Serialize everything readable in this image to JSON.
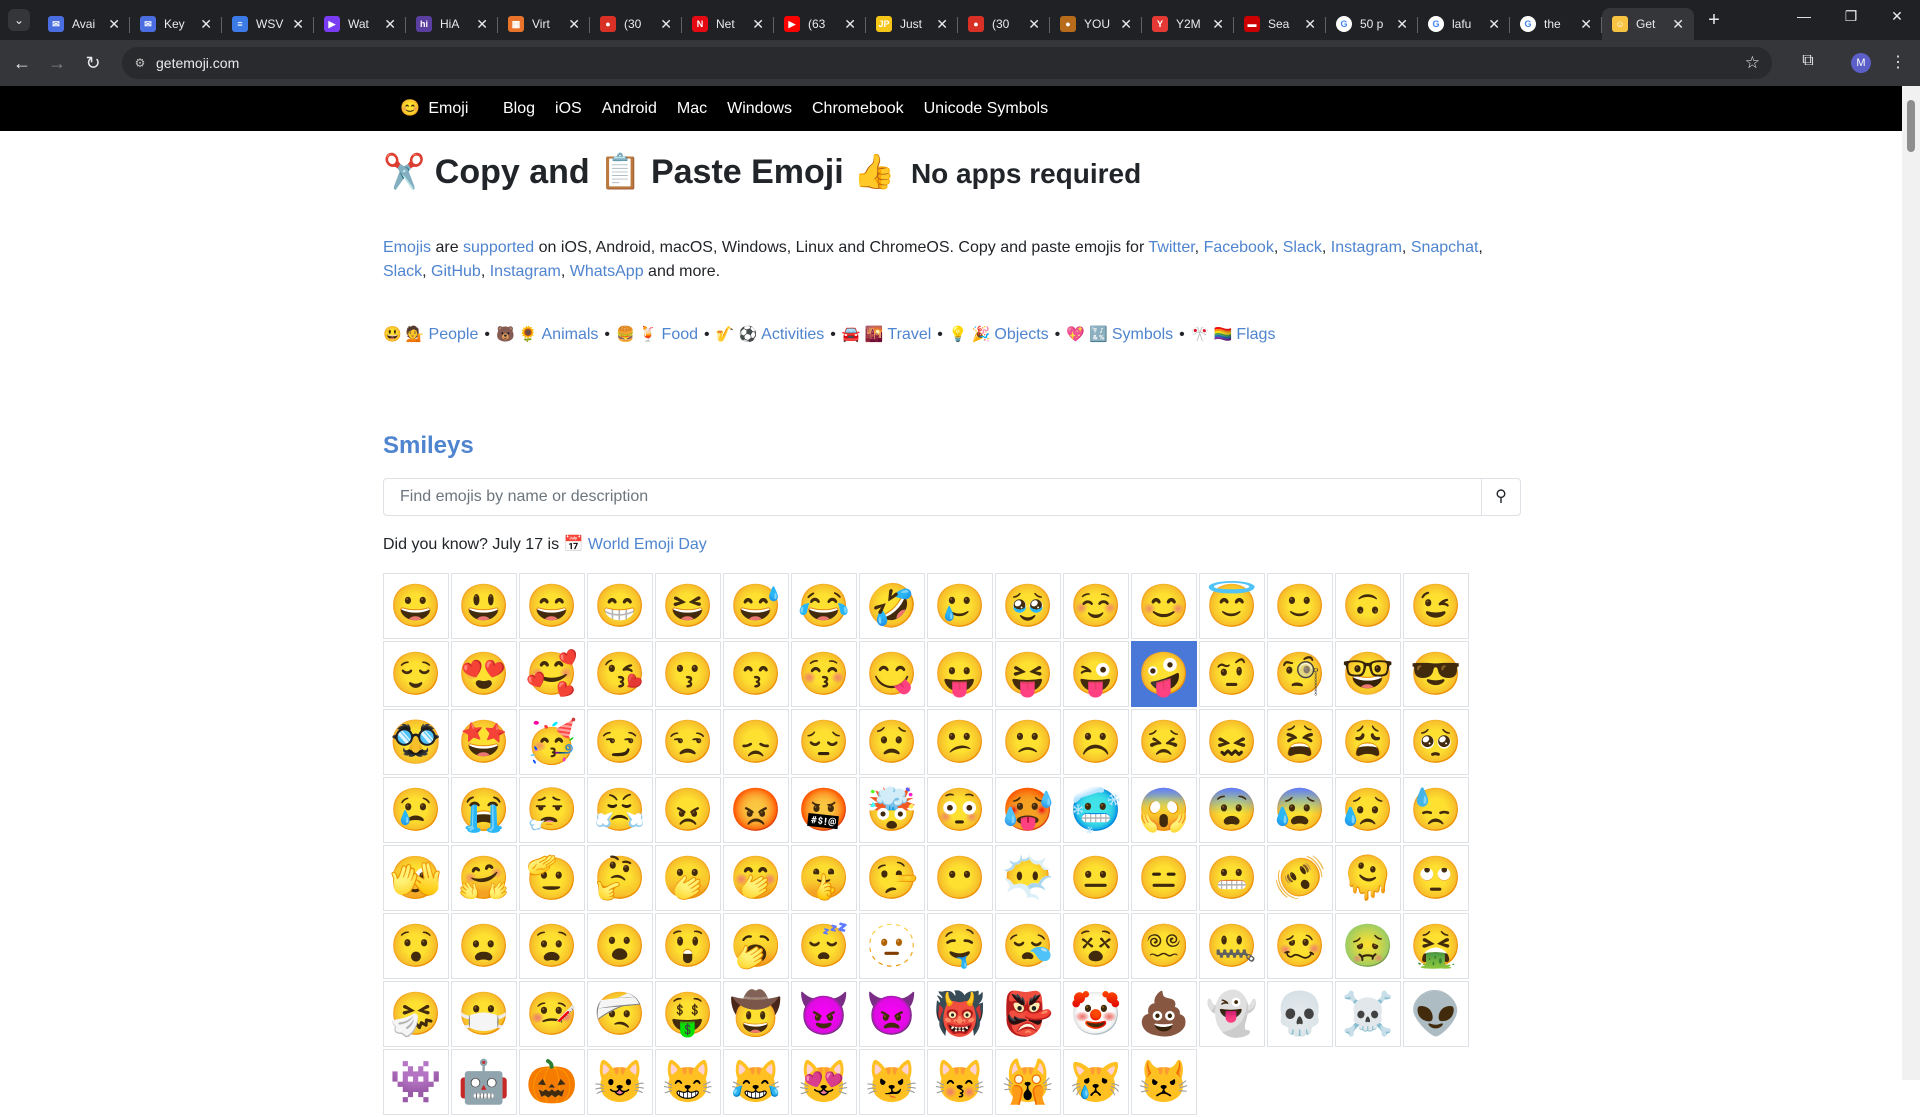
{
  "browser": {
    "tabs": [
      {
        "title": "Avai",
        "icon_color": "#4a6ee0",
        "glyph": "✉"
      },
      {
        "title": "Key",
        "icon_color": "#4a6ee0",
        "glyph": "✉"
      },
      {
        "title": "WSV",
        "icon_color": "#3c7be7",
        "glyph": "≡"
      },
      {
        "title": "Wat",
        "icon_color": "#7a3cf2",
        "glyph": "▶"
      },
      {
        "title": "HiA",
        "icon_color": "#5a3fa0",
        "glyph": "hi"
      },
      {
        "title": "Virt",
        "icon_color": "#e8742c",
        "glyph": "▦"
      },
      {
        "title": "(30",
        "icon_color": "#d93025",
        "glyph": "●"
      },
      {
        "title": "Net",
        "icon_color": "#e50914",
        "glyph": "N"
      },
      {
        "title": "(63",
        "icon_color": "#ff0000",
        "glyph": "▶"
      },
      {
        "title": "Just",
        "icon_color": "#f5c518",
        "glyph": "JP"
      },
      {
        "title": "(30",
        "icon_color": "#d93025",
        "glyph": "●"
      },
      {
        "title": "YOU",
        "icon_color": "#b86b1b",
        "glyph": "●"
      },
      {
        "title": "Y2M",
        "icon_color": "#e53935",
        "glyph": "Y"
      },
      {
        "title": "Sea",
        "icon_color": "#cc0000",
        "glyph": "▬"
      },
      {
        "title": "50 p",
        "icon_color": "#ffffff",
        "glyph": "G"
      },
      {
        "title": "lafu",
        "icon_color": "#ffffff",
        "glyph": "G"
      },
      {
        "title": "the",
        "icon_color": "#ffffff",
        "glyph": "G"
      },
      {
        "title": "Get",
        "icon_color": "#f6c343",
        "glyph": "☺"
      }
    ],
    "url": "getemoji.com",
    "profile_initial": "M"
  },
  "nav": {
    "brand_icon": "😊",
    "brand": "Emoji",
    "links": [
      "Blog",
      "iOS",
      "Android",
      "Mac",
      "Windows",
      "Chromebook",
      "Unicode Symbols"
    ]
  },
  "headline": {
    "e1": "✂️",
    "t1": "Copy and",
    "e2": "📋",
    "t2": "Paste Emoji",
    "e3": "👍",
    "sub": "No apps required"
  },
  "intro": {
    "w_emojis": "Emojis",
    "t_are": " are ",
    "w_supported": "supported",
    "t_platforms": " on iOS, Android, macOS, Windows, Linux and ChromeOS. Copy and paste emojis for ",
    "w_twitter": "Twitter",
    "w_facebook": "Facebook",
    "w_slack": "Slack",
    "w_instagram": "Instagram",
    "w_snapchat": "Snapchat",
    "w_slack2": "Slack",
    "w_github": "GitHub",
    "w_instagram2": "Instagram",
    "w_whatsapp": "WhatsApp",
    "t_end": " and more.",
    "comma": ","
  },
  "categories": [
    {
      "icons": "😃 💁",
      "label": "People"
    },
    {
      "icons": "🐻 🌻",
      "label": "Animals"
    },
    {
      "icons": "🍔 🍹",
      "label": "Food"
    },
    {
      "icons": "🎷 ⚽️",
      "label": "Activities"
    },
    {
      "icons": "🚘 🌇",
      "label": "Travel"
    },
    {
      "icons": "💡 🎉",
      "label": "Objects"
    },
    {
      "icons": "💖 🔣",
      "label": "Symbols"
    },
    {
      "icons": "🎌 🏳️‍🌈",
      "label": "Flags"
    }
  ],
  "bullet": "•",
  "section_title": "Smileys",
  "search": {
    "placeholder": "Find emojis by name or description"
  },
  "did_you_know": {
    "text": "Did you know? July 17 is",
    "icon": "📅",
    "link": "World Emoji Day"
  },
  "emojis": [
    "😀",
    "😃",
    "😄",
    "😁",
    "😆",
    "😅",
    "😂",
    "🤣",
    "🥲",
    "🥹",
    "☺️",
    "😊",
    "😇",
    "🙂",
    "🙃",
    "😉",
    "😌",
    "😍",
    "🥰",
    "😘",
    "😗",
    "😙",
    "😚",
    "😋",
    "😛",
    "😝",
    "😜",
    "🤪",
    "🤨",
    "🧐",
    "🤓",
    "😎",
    "🥸",
    "🤩",
    "🥳",
    "😏",
    "😒",
    "😞",
    "😔",
    "😟",
    "😕",
    "🙁",
    "☹️",
    "😣",
    "😖",
    "😫",
    "😩",
    "🥺",
    "😢",
    "😭",
    "😮‍💨",
    "😤",
    "😠",
    "😡",
    "🤬",
    "🤯",
    "😳",
    "🥵",
    "🥶",
    "😱",
    "😨",
    "😰",
    "😥",
    "😓",
    "🫣",
    "🤗",
    "🫡",
    "🤔",
    "🫢",
    "🤭",
    "🤫",
    "🤥",
    "😶",
    "😶‍🌫️",
    "😐",
    "😑",
    "😬",
    "🫨",
    "🫠",
    "🙄",
    "😯",
    "😦",
    "😧",
    "😮",
    "😲",
    "🥱",
    "😴",
    "🫥",
    "🤤",
    "😪",
    "😵",
    "😵‍💫",
    "🤐",
    "🥴",
    "🤢",
    "🤮",
    "🤧",
    "😷",
    "🤒",
    "🤕",
    "🤑",
    "🤠",
    "😈",
    "👿",
    "👹",
    "👺",
    "🤡",
    "💩",
    "👻",
    "💀",
    "☠️",
    "👽",
    "👾",
    "🤖",
    "🎃",
    "😺",
    "😸",
    "😹",
    "😻",
    "😼",
    "😽",
    "🙀",
    "😿",
    "😾"
  ],
  "selected_index": 27
}
